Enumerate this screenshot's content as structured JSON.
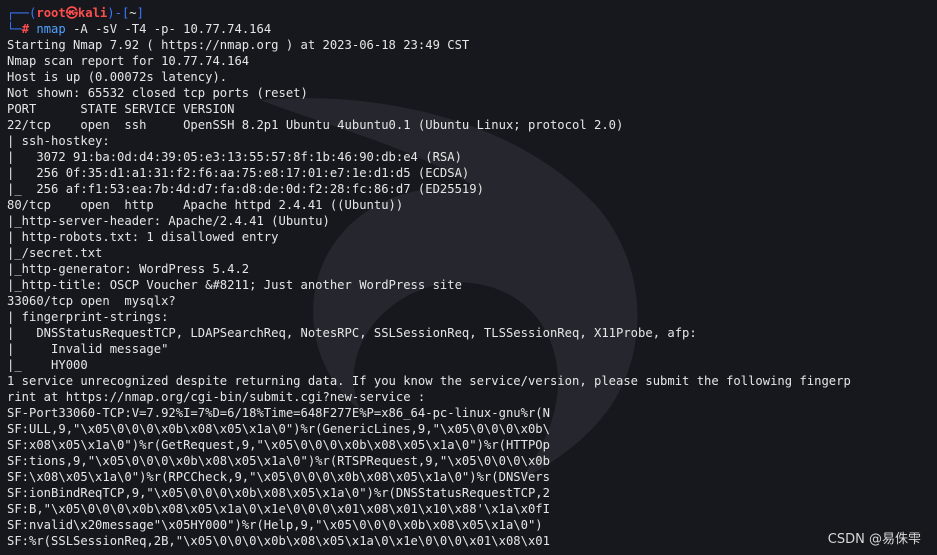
{
  "prompt": {
    "top_left": "┌──(",
    "user": "root",
    "at": "㉿",
    "host": "kali",
    "close": ")-[",
    "dir": "~",
    "end": "]",
    "bottom_left": "└─",
    "hash": "# ",
    "command": "nmap",
    "args": " -A -sV -T4 -p- 10.77.74.164"
  },
  "output_lines": [
    "Starting Nmap 7.92 ( https://nmap.org ) at 2023-06-18 23:49 CST",
    "Nmap scan report for 10.77.74.164",
    "Host is up (0.00072s latency).",
    "Not shown: 65532 closed tcp ports (reset)",
    "PORT      STATE SERVICE VERSION",
    "22/tcp    open  ssh     OpenSSH 8.2p1 Ubuntu 4ubuntu0.1 (Ubuntu Linux; protocol 2.0)",
    "| ssh-hostkey:",
    "|   3072 91:ba:0d:d4:39:05:e3:13:55:57:8f:1b:46:90:db:e4 (RSA)",
    "|   256 0f:35:d1:a1:31:f2:f6:aa:75:e8:17:01:e7:1e:d1:d5 (ECDSA)",
    "|_  256 af:f1:53:ea:7b:4d:d7:fa:d8:de:0d:f2:28:fc:86:d7 (ED25519)",
    "80/tcp    open  http    Apache httpd 2.4.41 ((Ubuntu))",
    "|_http-server-header: Apache/2.4.41 (Ubuntu)",
    "| http-robots.txt: 1 disallowed entry",
    "|_/secret.txt",
    "|_http-generator: WordPress 5.4.2",
    "|_http-title: OSCP Voucher &#8211; Just another WordPress site",
    "33060/tcp open  mysqlx?",
    "| fingerprint-strings:",
    "|   DNSStatusRequestTCP, LDAPSearchReq, NotesRPC, SSLSessionReq, TLSSessionReq, X11Probe, afp:",
    "|     Invalid message\"",
    "|_    HY000",
    "1 service unrecognized despite returning data. If you know the service/version, please submit the following fingerp",
    "rint at https://nmap.org/cgi-bin/submit.cgi?new-service :",
    "SF-Port33060-TCP:V=7.92%I=7%D=6/18%Time=648F277E%P=x86_64-pc-linux-gnu%r(N",
    "SF:ULL,9,\"\\x05\\0\\0\\0\\x0b\\x08\\x05\\x1a\\0\")%r(GenericLines,9,\"\\x05\\0\\0\\0\\x0b\\",
    "SF:x08\\x05\\x1a\\0\")%r(GetRequest,9,\"\\x05\\0\\0\\0\\x0b\\x08\\x05\\x1a\\0\")%r(HTTPOp",
    "SF:tions,9,\"\\x05\\0\\0\\0\\x0b\\x08\\x05\\x1a\\0\")%r(RTSPRequest,9,\"\\x05\\0\\0\\0\\x0b",
    "SF:\\x08\\x05\\x1a\\0\")%r(RPCCheck,9,\"\\x05\\0\\0\\0\\x0b\\x08\\x05\\x1a\\0\")%r(DNSVers",
    "SF:ionBindReqTCP,9,\"\\x05\\0\\0\\0\\x0b\\x08\\x05\\x1a\\0\")%r(DNSStatusRequestTCP,2",
    "SF:B,\"\\x05\\0\\0\\0\\x0b\\x08\\x05\\x1a\\0\\x1e\\0\\0\\0\\x01\\x08\\x01\\x10\\x88'\\x1a\\x0fI",
    "SF:nvalid\\x20message\"\\x05HY000\")%r(Help,9,\"\\x05\\0\\0\\0\\x0b\\x08\\x05\\x1a\\0\")",
    "SF:%r(SSLSessionReq,2B,\"\\x05\\0\\0\\0\\x0b\\x08\\x05\\x1a\\0\\x1e\\0\\0\\0\\x01\\x08\\x01"
  ],
  "watermark": "CSDN @易侏雫",
  "colors": {
    "background": "#17181e",
    "prompt_blue": "#3b78ff",
    "prompt_red": "#ff4d4d",
    "command_blue": "#4fa3ff",
    "text": "#e6e6e6"
  },
  "icons": {
    "background": "kali-dragon-icon"
  }
}
